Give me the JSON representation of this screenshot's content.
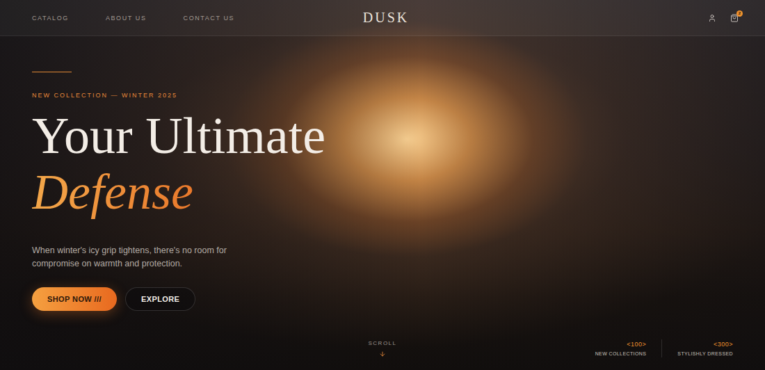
{
  "nav": {
    "links": [
      {
        "label": "CATALOG"
      },
      {
        "label": "ABOUT US"
      },
      {
        "label": "CONTACT US"
      }
    ],
    "logo": "DUSK",
    "cart_badge": "2"
  },
  "hero": {
    "eyebrow": "NEW COLLECTION — WINTER 2025",
    "title_line1": "Your Ultimate",
    "title_line2": "Defense",
    "description": "When winter's icy grip tightens, there's no room for compromise on warmth and protection.",
    "buttons": [
      {
        "label": "SHOP NOW ///",
        "kind": "primary"
      },
      {
        "label": "EXPLORE",
        "kind": "secondary"
      }
    ]
  },
  "scroll": {
    "label": "SCROLL"
  },
  "stats": [
    {
      "value": "<100>",
      "label": "NEW COLLECTIONS"
    },
    {
      "value": "<300>",
      "label": "STYLISHLY DRESSED"
    }
  ]
}
